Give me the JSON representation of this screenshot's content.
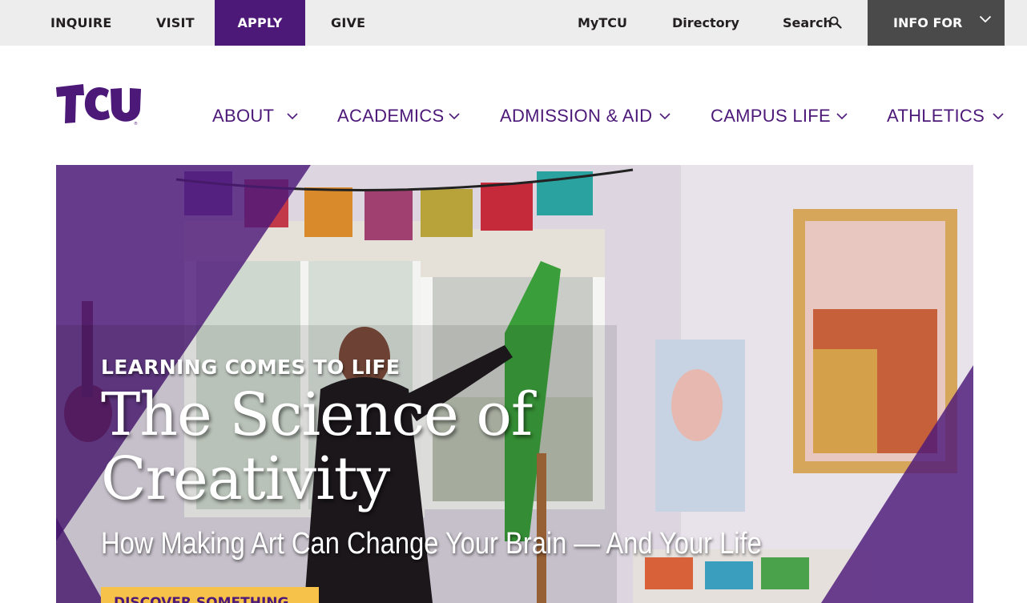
{
  "utility_nav": {
    "inquire": "INQUIRE",
    "visit": "VISIT",
    "apply": "APPLY",
    "give": "GIVE",
    "mytcu": "MyTCU",
    "directory": "Directory",
    "search": "Search",
    "search_icon": "magnifier-icon",
    "info_for": "INFO FOR",
    "info_for_icon": "chevron-down-icon"
  },
  "logo": {
    "text": "TCU"
  },
  "main_nav": {
    "about": "ABOUT",
    "academics": "ACADEMICS",
    "admission": "ADMISSION & AID",
    "campus_life": "CAMPUS LIFE",
    "athletics": "ATHLETICS"
  },
  "hero": {
    "eyebrow": "LEARNING COMES TO LIFE",
    "headline": "The Science of Creativity",
    "subhead": "How Making Art Can Change Your Brain — And Your Life",
    "cta": "DISCOVER SOMETHING"
  },
  "colors": {
    "brand_purple": "#4d1979",
    "util_bar": "#ededed",
    "info_for_bg": "#4a4a4a",
    "cta_yellow": "#f6c24a"
  }
}
